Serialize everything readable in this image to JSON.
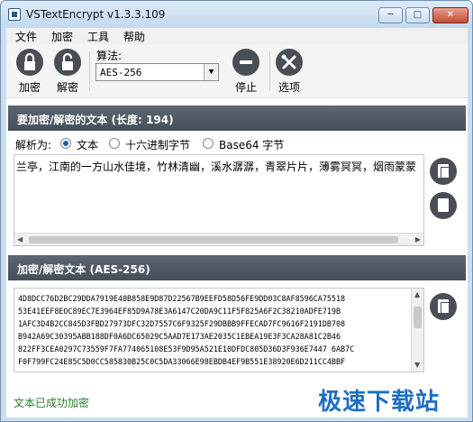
{
  "window": {
    "title": "VSTextEncrypt v1.3.3.109",
    "minimize": "─",
    "maximize": "□",
    "close": "✕"
  },
  "menu": [
    "文件",
    "加密",
    "工具",
    "帮助"
  ],
  "toolbar": {
    "encrypt_label": "加密",
    "decrypt_label": "解密",
    "algorithm_label": "算法:",
    "algorithm_value": "AES-256",
    "stop_label": "停止",
    "options_label": "选项"
  },
  "input_section": {
    "header": "要加密/解密的文本 (长度: 194)",
    "parse_label": "解析为:",
    "options": [
      "文本",
      "十六进制字节",
      "Base64 字节"
    ],
    "selected": "文本",
    "text": "兰亭，江南的一方山水佳境，竹林清幽，溪水潺潺，青翠片片，薄雾冥冥，烟雨蒙蒙"
  },
  "output_section": {
    "header": "加密/解密文本 (AES-256)",
    "lines": [
      "4D8DCC76D2BC29DDA7919E40B858E9D87D22567B9EEFD58D56FE9DD03C8AF8596CA75518",
      "53E41EEF8EOC89EC7E3964EF85D9A78E3A6147C20DA9C11F5F825A6F2C38210ADFE719B",
      "1AFC3D4B2CC845D3FBD27973DFC32D7557C6F9325F29DBBB9FFECAD7FC9616F2191DB708",
      "B942A69C30395ABB188DF0A6DC65029C5AAD7E173AE2035C1EBEA19E3F3CA28A81C2B46",
      "822FF3CEA0297C73559F7FA774065108E53F9D95A521E10DFDC805D36D3F936E7447 6AB7C",
      "F0F799FC24E85C5D0CC585830B25C0C5DA33066E98EBDB4EF9B551E38920E6D211CC4BBF"
    ]
  },
  "status": "文本已成功加密",
  "watermark": "极速下载站"
}
